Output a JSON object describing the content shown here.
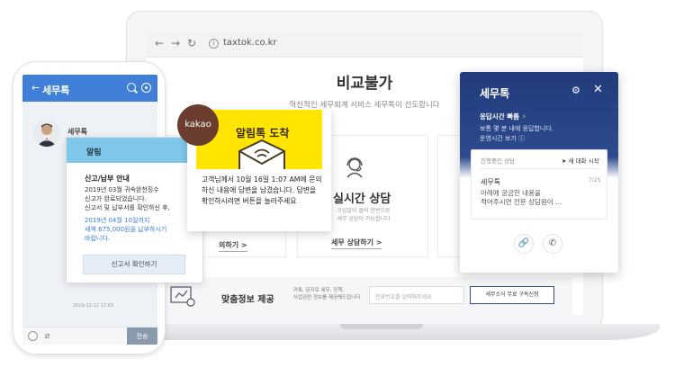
{
  "browser": {
    "back": "←",
    "forward": "→",
    "reload": "↻",
    "url_icon": "i",
    "url": "taxtok.co.kr"
  },
  "page": {
    "title": "비교불가",
    "subtitle": "혁신적인 세무회계 서비스 세무톡이 선도합니다",
    "left_card_link": "의하기 >",
    "middle_card": {
      "title": "실시간 상담",
      "desc_line1": "가입없이 클릭 한번으로",
      "desc_line2": "세무 상담이 가능합니다",
      "link": "세무 상담하기 >"
    },
    "promo": {
      "title": "맞춤정보 제공",
      "desc_line1": "카톡, 문자로 세무, 정책,",
      "desc_line2": "사업관련 정보를 제공해드립니다",
      "input_placeholder": "전화번호를 입력해주세요",
      "button": "세무소식 무료 구독신청"
    }
  },
  "phone": {
    "back": "←",
    "title": "세무톡",
    "sender": "세무톡",
    "time": "2019-12-12 17:03",
    "send": "전송"
  },
  "notice": {
    "header": "알림",
    "title": "신고/납부 안내",
    "line1": "2019년 03월 귀속완천징수",
    "line2": "신고가 완료되었습니다.",
    "line3": "신고서 및 납부서를 확인하신 후,",
    "line4": "2019년 04월 10일까지",
    "line5": "세액 675,000원을 납부하시기",
    "line6": "바랍니다.",
    "button": "신고서 확인하기"
  },
  "alimtalk": {
    "badge": "kakao",
    "title": "알림톡 도착",
    "text": "고객님께서 10월 16일 1:07 AM에 문의하신 내용에 답변을 남겼습니다. 답변을 확인하시려면 버튼을 눌러주세요"
  },
  "widget": {
    "title": "세무톡",
    "gear": "⚙",
    "close": "✕",
    "fast": "응답시간 빠름",
    "fast_bolt": "⚡",
    "sub_line1": "보통 몇 분 내에 응답합니다.",
    "sub_line2": "운영시간 보기 ⓘ",
    "conv_status": "진행중인 상담",
    "conv_new": "➤ 새 대화 시작",
    "conv_name": "세무톡",
    "conv_date": "7/25",
    "conv_msg1": "아래에 궁금한 내용을",
    "conv_msg2": "적어주시면 전문 상담원이 …",
    "link_btn": "🔗",
    "call_btn": "✆"
  },
  "colors": {
    "phone_header": "#3f7fd8",
    "notice_header": "#7fc8ea",
    "alim_yellow": "#ffe500",
    "kakao_brown": "#6b3d2f",
    "widget_navy": "#213b7c"
  }
}
